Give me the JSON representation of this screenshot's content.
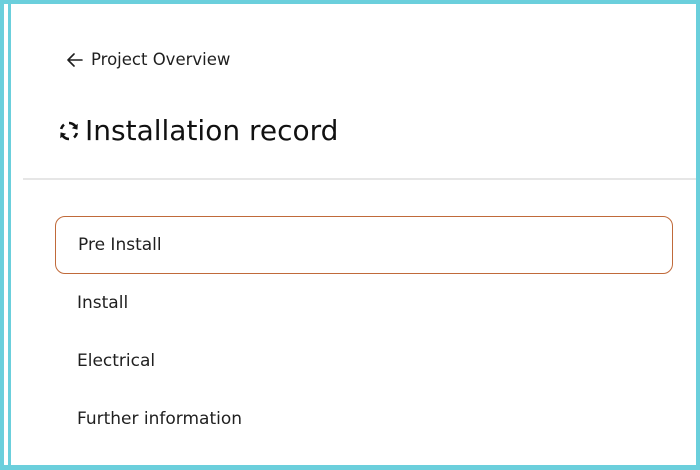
{
  "nav": {
    "back_label": "Project Overview",
    "back_icon": "arrow-left-icon"
  },
  "header": {
    "title": "Installation record",
    "icon": "sync-icon"
  },
  "steps": [
    {
      "label": "Pre Install",
      "active": true
    },
    {
      "label": "Install",
      "active": false
    },
    {
      "label": "Electrical",
      "active": false
    },
    {
      "label": "Further information",
      "active": false
    }
  ],
  "colors": {
    "frame_border": "#6bcfdc",
    "active_step_border": "#c06a3a",
    "divider": "#e6e6e6"
  }
}
